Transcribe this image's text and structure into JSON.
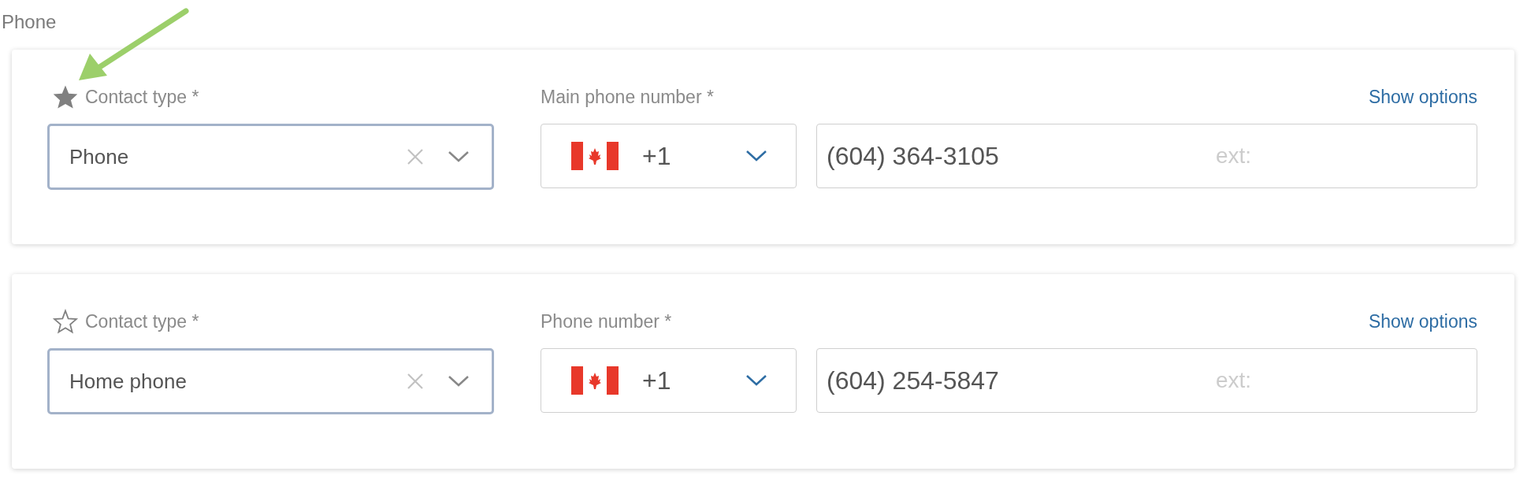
{
  "section_label": "Phone",
  "contacts": [
    {
      "starred": true,
      "type_label": "Contact type *",
      "type_value": "Phone",
      "number_label": "Main phone number *",
      "options_link": "Show options",
      "dial_code": "+1",
      "number": "(604) 364-3105",
      "ext_placeholder": "ext:"
    },
    {
      "starred": false,
      "type_label": "Contact type *",
      "type_value": "Home phone",
      "number_label": "Phone number *",
      "options_link": "Show options",
      "dial_code": "+1",
      "number": "(604) 254-5847",
      "ext_placeholder": "ext:"
    }
  ]
}
